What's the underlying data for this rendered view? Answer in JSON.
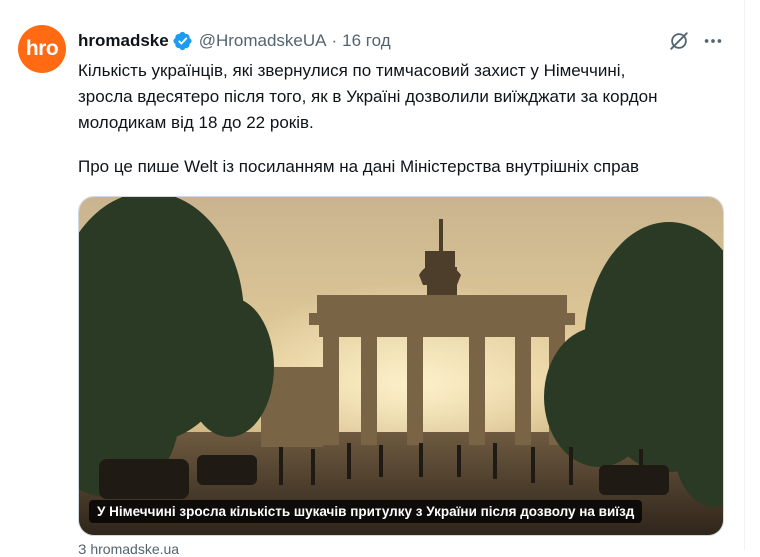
{
  "tweet": {
    "avatar_text": "hro",
    "author_name": "hromadske",
    "author_handle": "@HromadskeUA",
    "separator": "·",
    "time": "16 год",
    "paragraph_1": "Кількість українців, які звернулися по тимчасовий захист у Німеччині,\nзросла вдесятеро після того, як в Україні дозволили виїжджати за кордон\nмолодикам від 18 до 22 років.",
    "paragraph_2": "Про це пише Welt із посиланням на дані Міністерства внутрішніх справ"
  },
  "card": {
    "caption": "У Німеччині зросла кількість шукачів притулку з України після дозволу на виїзд",
    "source": "З hromadske.ua"
  },
  "icons": {
    "verified": "verified-badge-icon",
    "grok": "grok-icon",
    "more": "more-options-icon"
  },
  "colors": {
    "brand": "#ff6a13",
    "verified": "#1d9bf0",
    "muted": "#536471",
    "text": "#0f1419"
  }
}
